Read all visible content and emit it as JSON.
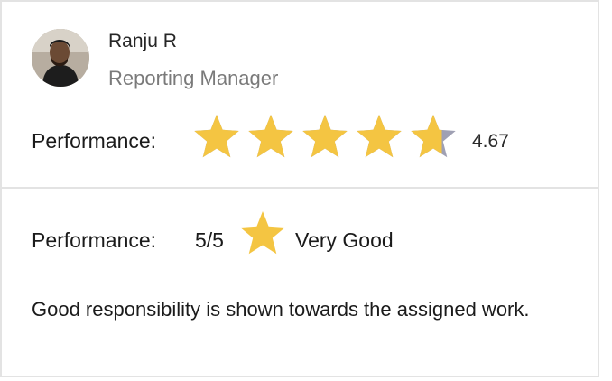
{
  "reviewer": {
    "name": "Ranju R",
    "role": "Reporting Manager"
  },
  "summary": {
    "label": "Performance:",
    "rating_value": "4.67",
    "rating": 4.67,
    "max_rating": 5,
    "star_color": "#f4c542",
    "star_empty_color": "#9fa0b3"
  },
  "review": {
    "label": "Performance:",
    "score": "5/5",
    "verdict": "Very Good",
    "comment": "Good responsibility is shown towards the assigned work."
  }
}
